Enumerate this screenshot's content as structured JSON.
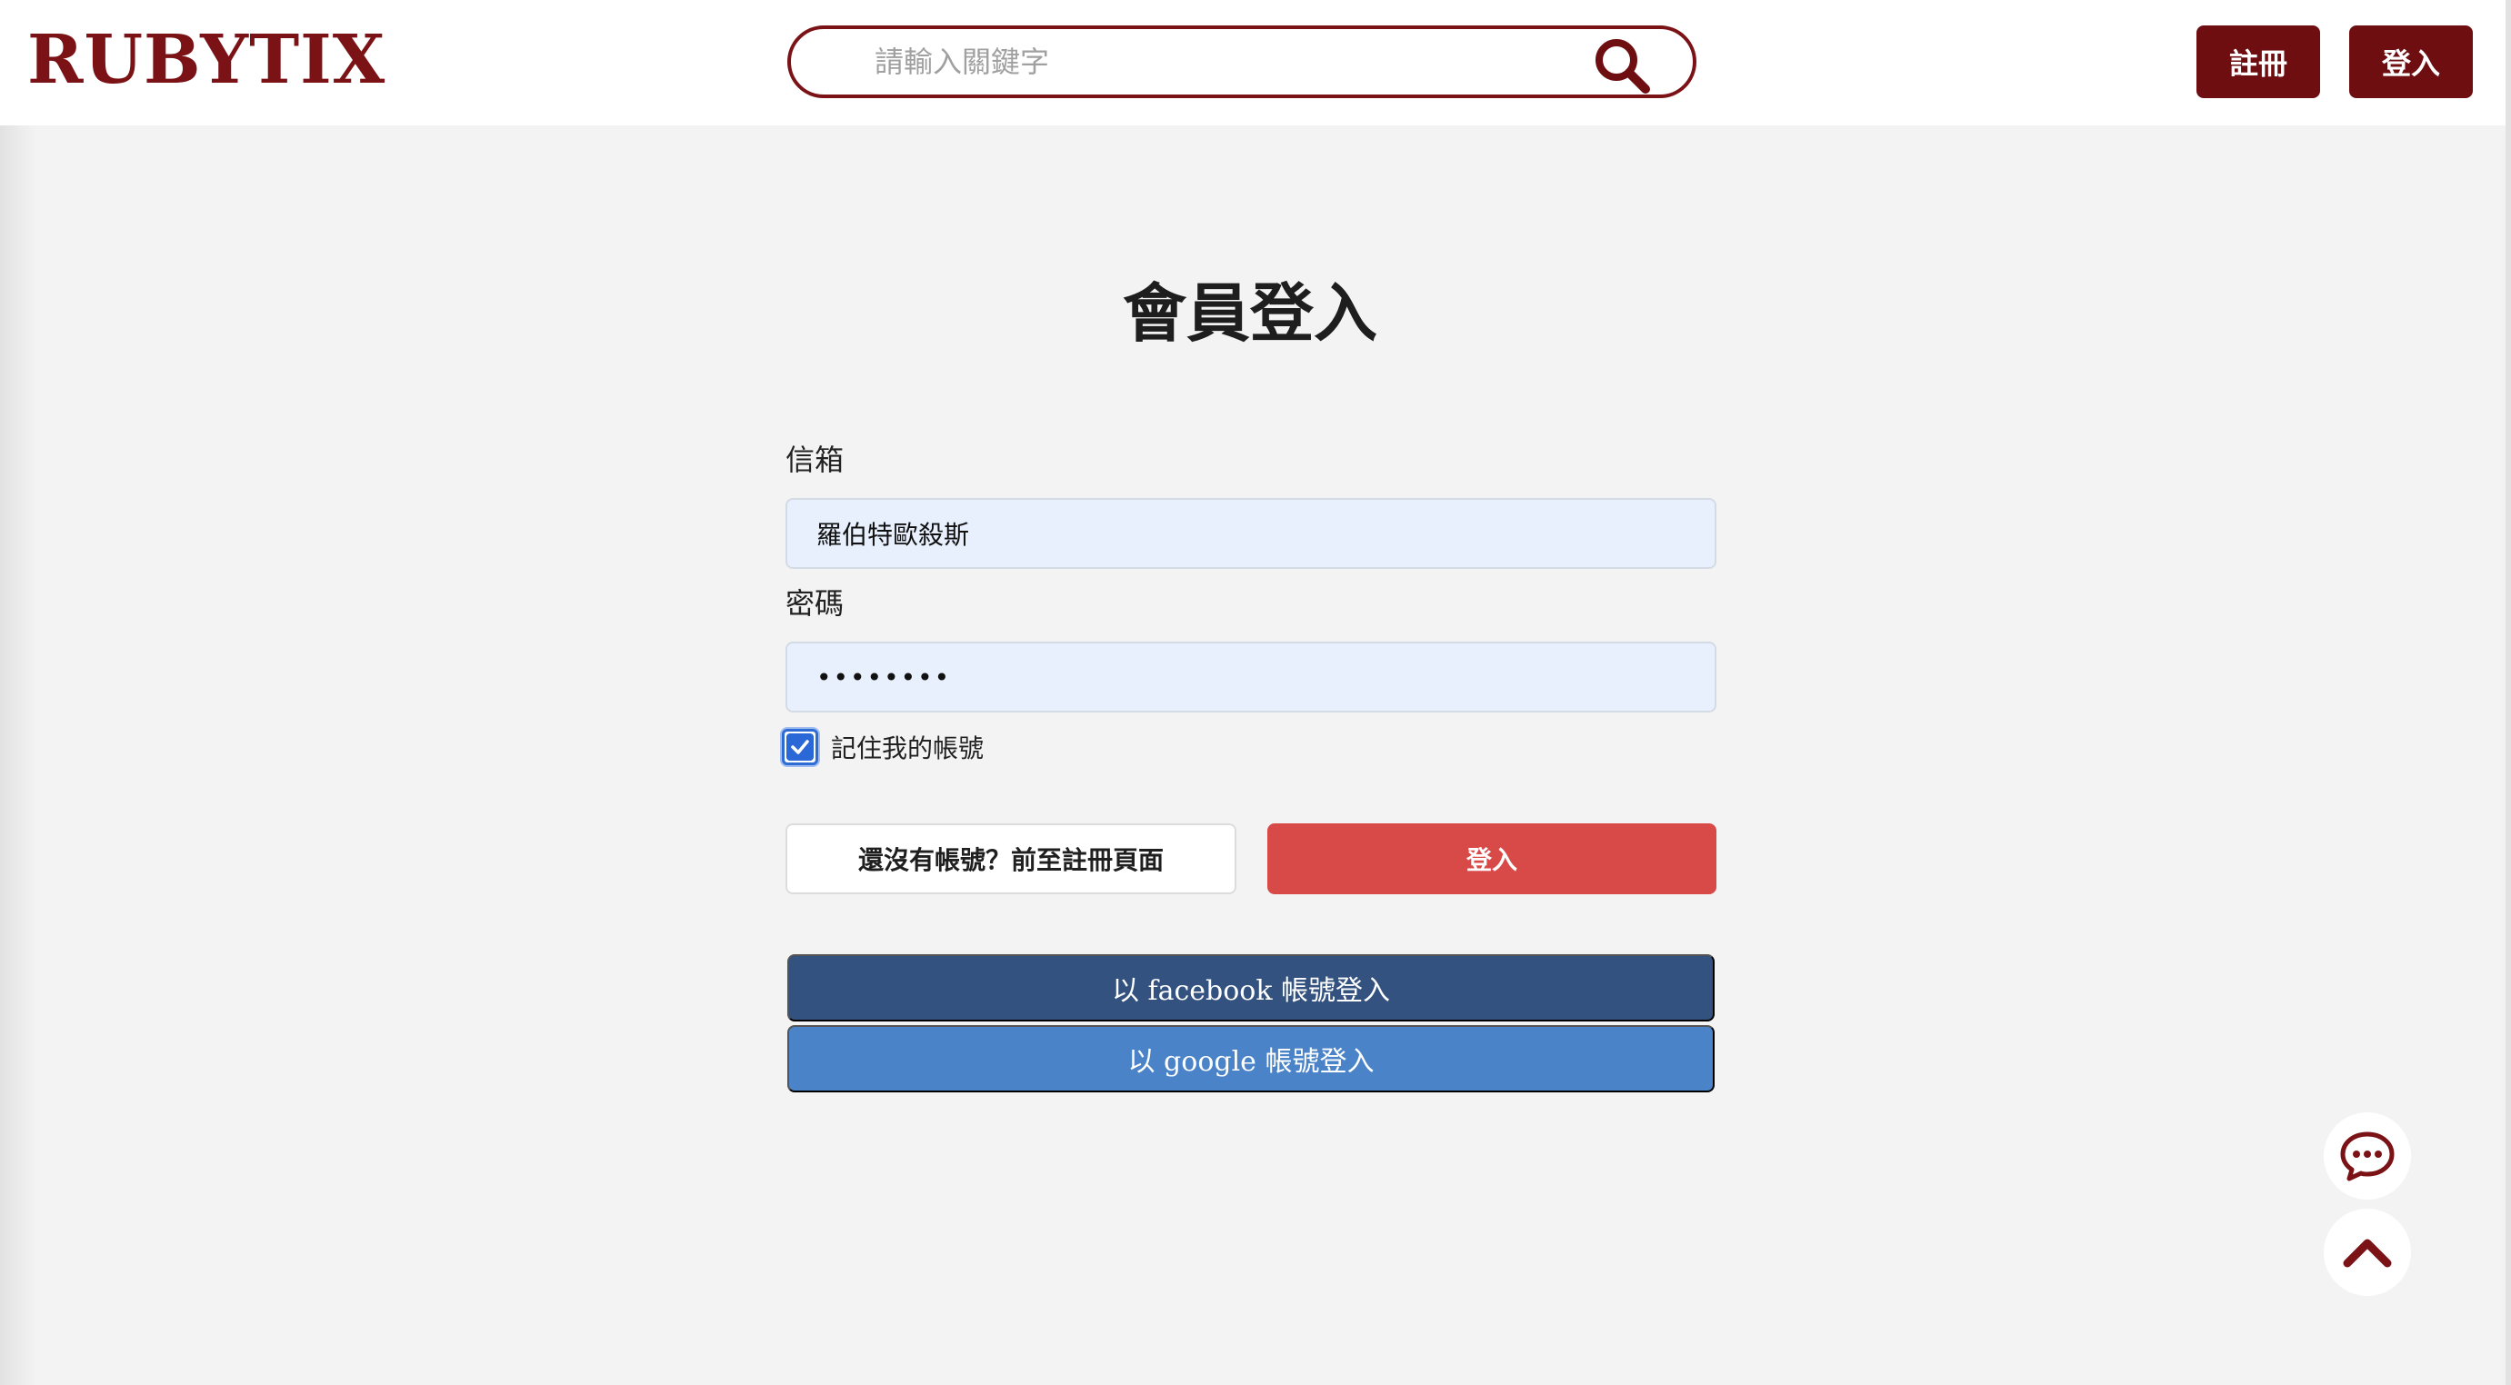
{
  "header": {
    "logo": "RUBYTIX",
    "search": {
      "placeholder": "請輸入關鍵字",
      "value": ""
    },
    "register_label": "註冊",
    "login_label": "登入"
  },
  "colors": {
    "brand": "#7a1216",
    "submit": "#d84a48",
    "facebook": "#33527f",
    "google": "#4a83c7",
    "input_bg": "#e8f0fe"
  },
  "form": {
    "title": "會員登入",
    "email_label": "信箱",
    "email_value": "羅伯特歐殺斯",
    "password_label": "密碼",
    "password_value": "••••••••",
    "remember_label": "記住我的帳號",
    "remember_checked": true,
    "goto_register_label": "還沒有帳號？前至註冊頁面",
    "submit_label": "登入",
    "facebook_label": "以 facebook 帳號登入",
    "google_label": "以 google 帳號登入"
  },
  "floating": {
    "chat_icon": "chat-bubble-icon",
    "top_icon": "chevron-up-icon"
  }
}
